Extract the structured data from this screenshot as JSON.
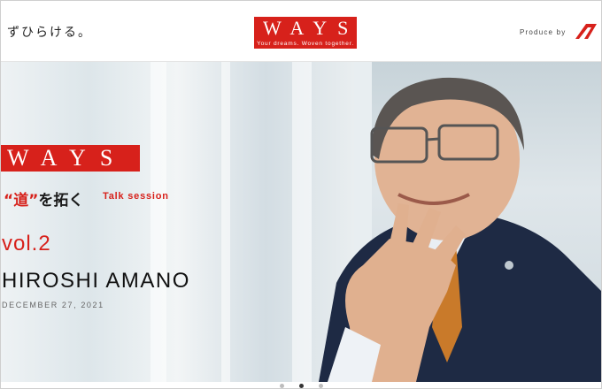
{
  "header": {
    "tagline": "ずひらける。",
    "logo_text": "WAYS",
    "logo_subtitle": "Your dreams. Woven together.",
    "produce_label": "Produce by"
  },
  "hero": {
    "logo_text": "WAYS",
    "michi_open_quote": "“",
    "michi_kanji": "道",
    "michi_close_quote": "”",
    "michi_rest": "を拓く",
    "talk_label": "Talk session",
    "vol": "vol.2",
    "name": "HIROSHI AMANO",
    "date": "DECEMBER 27, 2021"
  },
  "carousel": {
    "count": 3,
    "active_index": 1
  },
  "colors": {
    "brand_red": "#d7211b",
    "suit": "#1e2a44",
    "tie": "#c97a2a"
  },
  "icons": {
    "produce_mark": "brand-mark-icon"
  }
}
